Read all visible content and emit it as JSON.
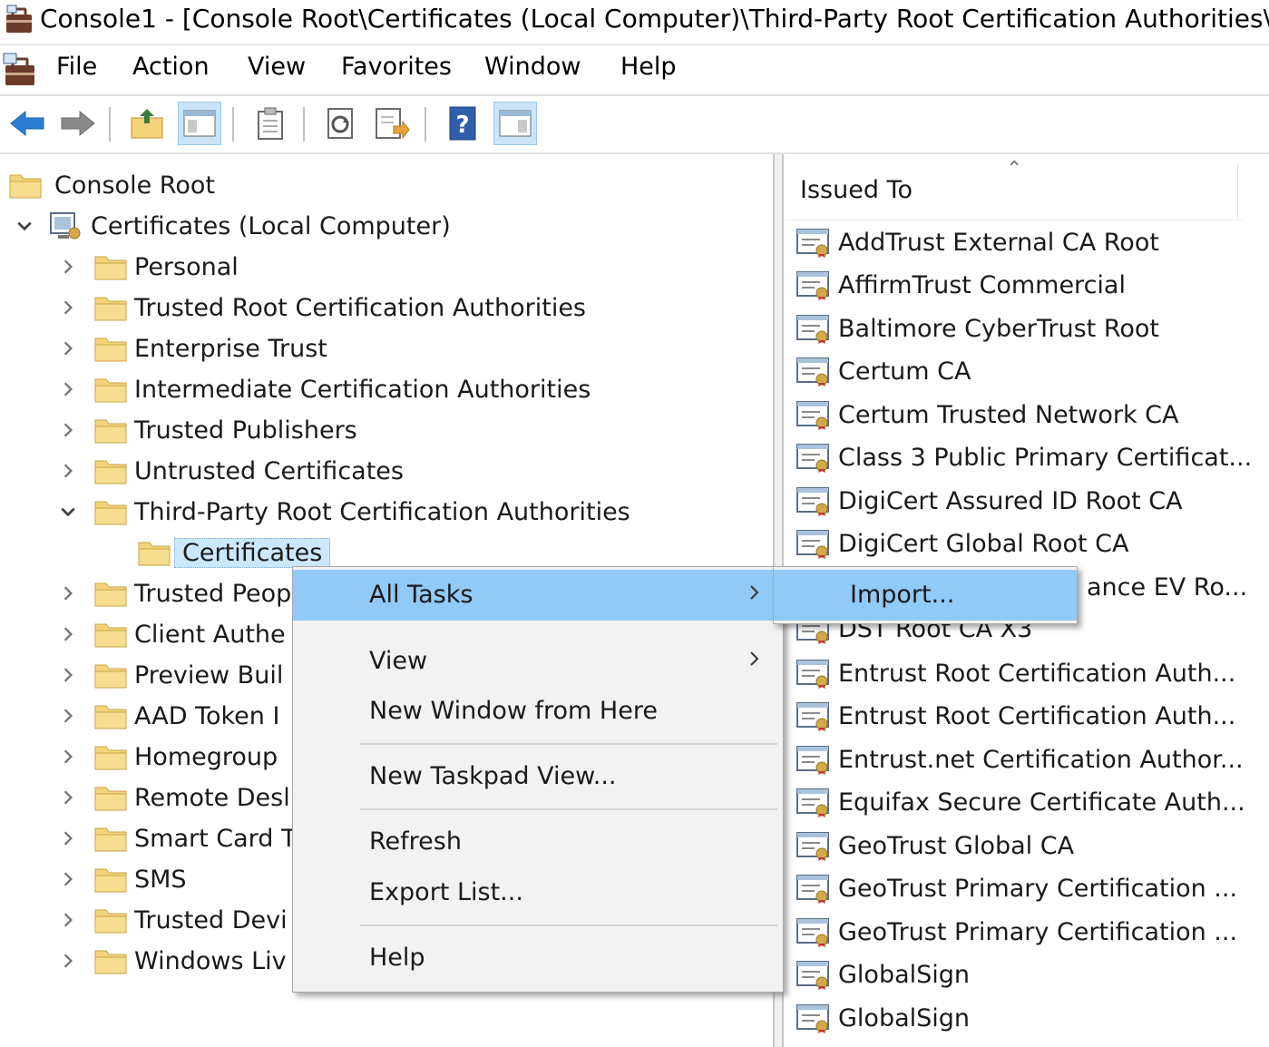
{
  "window": {
    "title": "Console1 - [Console Root\\Certificates (Local Computer)\\Third-Party Root Certification Authorities\\"
  },
  "menu": [
    "File",
    "Action",
    "View",
    "Favorites",
    "Window",
    "Help"
  ],
  "toolbar": {
    "buttons": [
      "back-arrow-icon",
      "forward-arrow-icon",
      "up-folder-icon",
      "show-hide-tree-icon",
      "properties-icon",
      "refresh-icon",
      "export-list-icon",
      "help-icon",
      "show-hide-action-pane-icon"
    ]
  },
  "tree": {
    "root": "Console Root",
    "computer": "Certificates (Local Computer)",
    "stores": [
      "Personal",
      "Trusted Root Certification Authorities",
      "Enterprise Trust",
      "Intermediate Certification Authorities",
      "Trusted Publishers",
      "Untrusted Certificates",
      "Third-Party Root Certification Authorities"
    ],
    "selected_child": "Certificates",
    "more_stores": [
      "Trusted Peop",
      "Client Authe",
      "Preview Buil",
      "AAD Token I",
      "Homegroup",
      "Remote Desl",
      "Smart Card T",
      "SMS",
      "Trusted Devi",
      "Windows Liv"
    ]
  },
  "list": {
    "column": "Issued To",
    "items": [
      "AddTrust External CA Root",
      "AffirmTrust Commercial",
      "Baltimore CyberTrust Root",
      "Certum CA",
      "Certum Trusted Network CA",
      "Class 3 Public Primary Certificat...",
      "DigiCert Assured ID Root CA",
      "DigiCert Global Root CA",
      "ance EV Ro...",
      "DST Root CA X3",
      "Entrust Root Certification Auth...",
      "Entrust Root Certification Auth...",
      "Entrust.net Certification Author...",
      "Equifax Secure Certificate Auth...",
      "GeoTrust Global CA",
      "GeoTrust Primary Certification ...",
      "GeoTrust Primary Certification ...",
      "GlobalSign",
      "GlobalSign"
    ]
  },
  "context_menu": {
    "all_tasks": "All Tasks",
    "view": "View",
    "new_window": "New Window from Here",
    "new_taskpad": "New Taskpad View...",
    "refresh": "Refresh",
    "export_list": "Export List...",
    "help": "Help"
  },
  "submenu": {
    "import": "Import..."
  },
  "colors": {
    "highlight": "#91c9f7",
    "selection": "#cce8ff",
    "menu_bg": "#f2f2f2",
    "folder": "#f5d37a"
  }
}
